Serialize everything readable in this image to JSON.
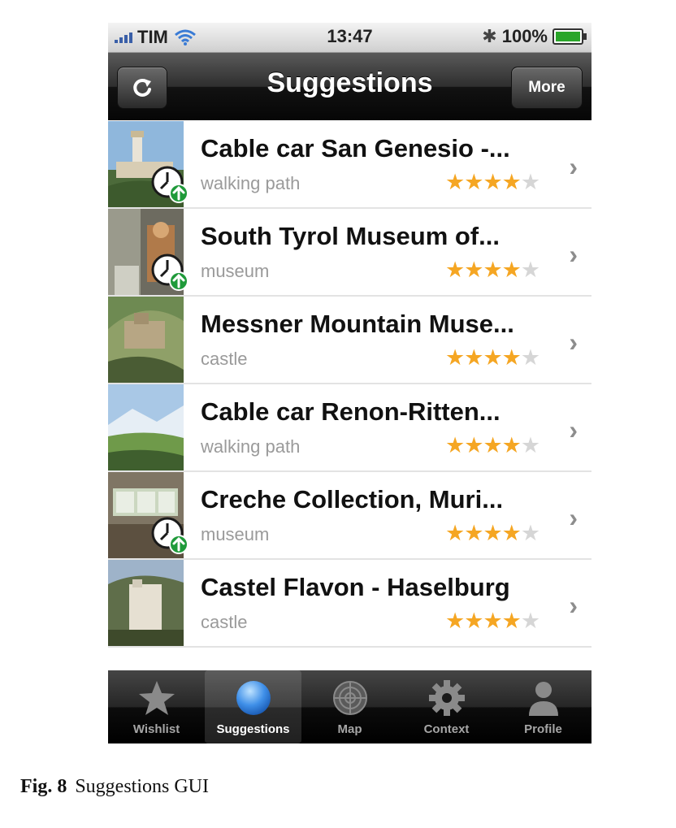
{
  "status_bar": {
    "carrier": "TIM",
    "time": "13:47",
    "battery": "100%",
    "battery_level": 1.0,
    "icons": [
      "signal-icon",
      "wifi-icon",
      "bluetooth-icon",
      "battery-icon"
    ]
  },
  "nav": {
    "title": "Suggestions",
    "left_icon": "refresh-icon",
    "right_button": "More"
  },
  "suggestions": [
    {
      "title": "Cable car San Genesio -...",
      "category": "walking path",
      "rating": 4,
      "max_rating": 5,
      "has_badge": true
    },
    {
      "title": "South Tyrol Museum of...",
      "category": "museum",
      "rating": 4,
      "max_rating": 5,
      "has_badge": true
    },
    {
      "title": "Messner Mountain Muse...",
      "category": "castle",
      "rating": 4,
      "max_rating": 5,
      "has_badge": false
    },
    {
      "title": "Cable car Renon-Ritten...",
      "category": "walking path",
      "rating": 4,
      "max_rating": 5,
      "has_badge": false
    },
    {
      "title": "Creche Collection, Muri...",
      "category": "museum",
      "rating": 4,
      "max_rating": 5,
      "has_badge": true
    },
    {
      "title": "Castel Flavon - Haselburg",
      "category": "castle",
      "rating": 4,
      "max_rating": 5,
      "has_badge": false
    }
  ],
  "tabs": [
    {
      "label": "Wishlist",
      "icon": "star-icon",
      "active": false
    },
    {
      "label": "Suggestions",
      "icon": "suggestions-orb-icon",
      "active": true
    },
    {
      "label": "Map",
      "icon": "radar-icon",
      "active": false
    },
    {
      "label": "Context",
      "icon": "gear-icon",
      "active": false
    },
    {
      "label": "Profile",
      "icon": "person-icon",
      "active": false
    }
  ],
  "caption": {
    "label": "Fig. 8",
    "text": "Suggestions GUI"
  },
  "colors": {
    "star_on": "#f5a623",
    "star_off": "#d6d6d6",
    "badge_green": "#1f9a3a",
    "orb_blue": "#3f8fe8"
  }
}
